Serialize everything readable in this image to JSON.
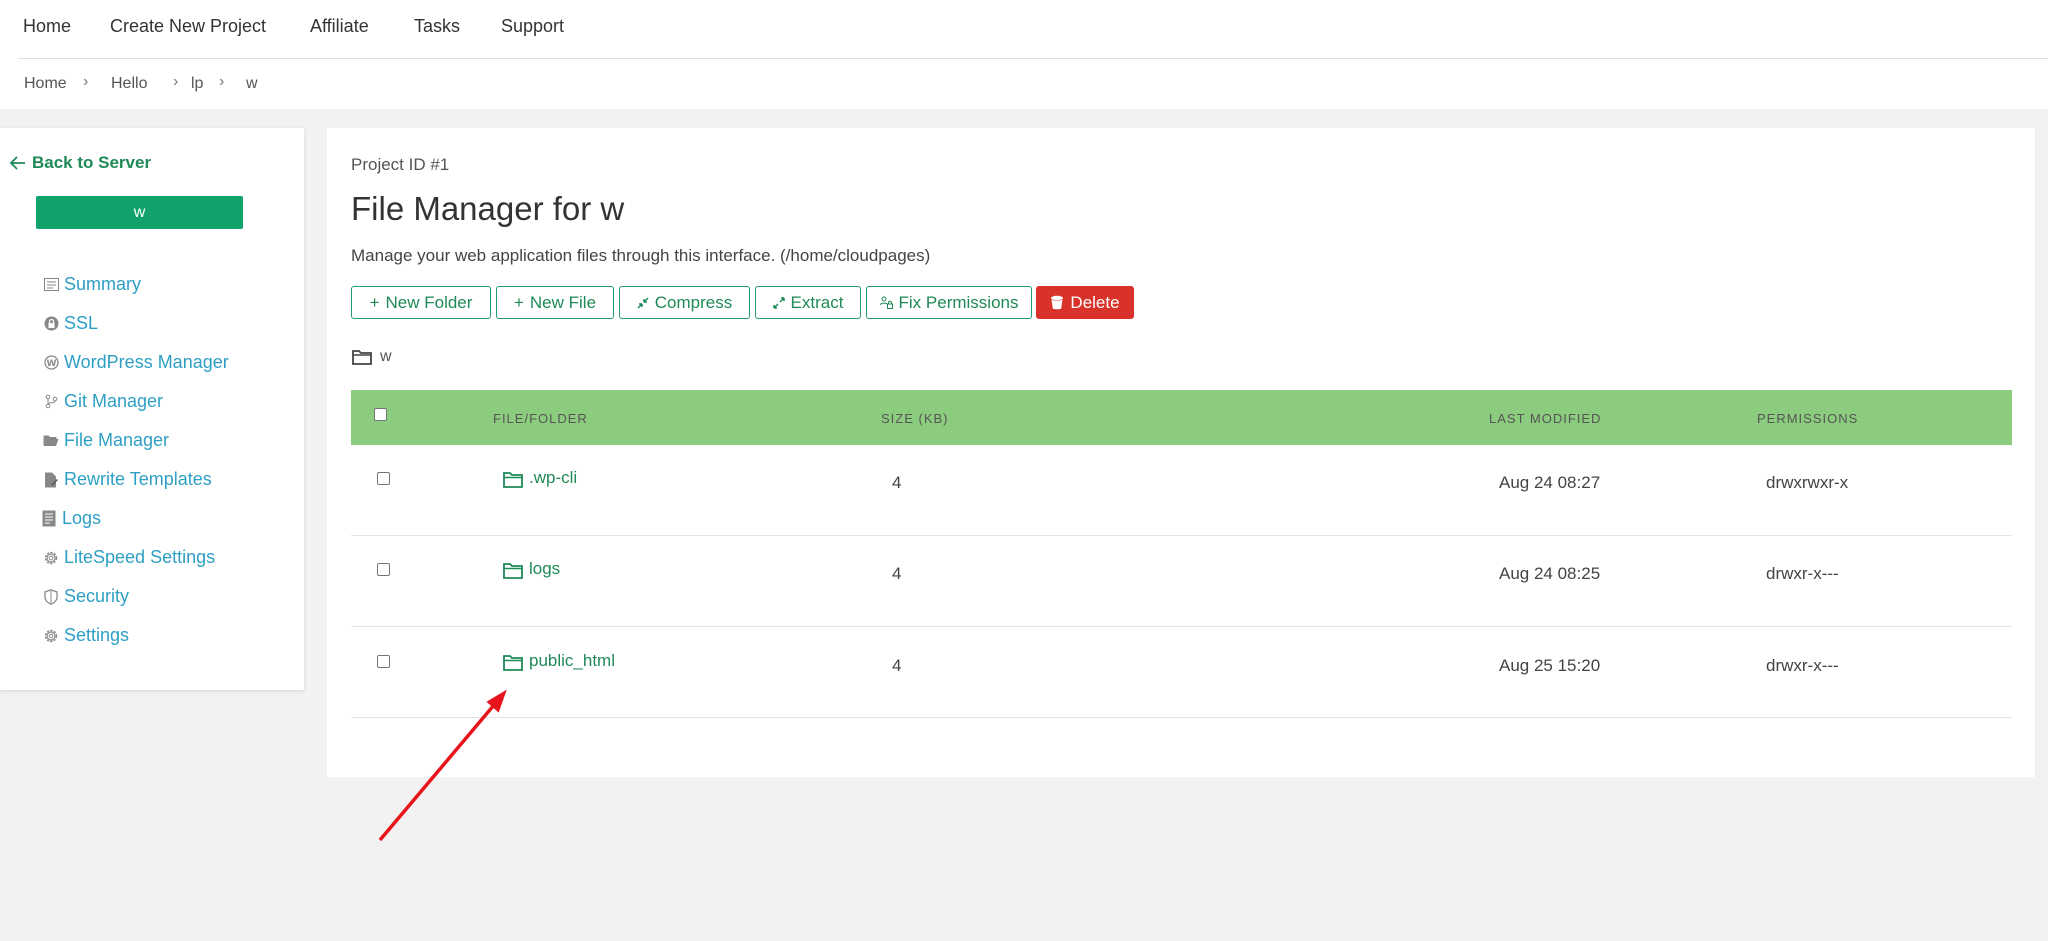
{
  "topnav": {
    "items": [
      "Home",
      "Create New Project",
      "Affiliate",
      "Tasks",
      "Support"
    ]
  },
  "breadcrumb": {
    "items": [
      "Home",
      "Hello",
      "lp",
      "w"
    ],
    "separator": "›"
  },
  "sidebar": {
    "back_label": "Back to Server",
    "project_name": "w",
    "items": [
      {
        "label": "Summary",
        "icon": "summary-icon"
      },
      {
        "label": "SSL",
        "icon": "lock-icon"
      },
      {
        "label": "WordPress Manager",
        "icon": "wordpress-icon"
      },
      {
        "label": "Git Manager",
        "icon": "git-icon"
      },
      {
        "label": "File Manager",
        "icon": "folder-open-icon"
      },
      {
        "label": "Rewrite Templates",
        "icon": "file-edit-icon"
      },
      {
        "label": "Logs",
        "icon": "logs-icon"
      },
      {
        "label": "LiteSpeed Settings",
        "icon": "gear-icon"
      },
      {
        "label": "Security",
        "icon": "shield-icon"
      },
      {
        "label": "Settings",
        "icon": "gear-icon"
      }
    ],
    "accent_color": "#10a26a",
    "link_color": "#2e9fc4"
  },
  "main": {
    "project_id": "Project ID #1",
    "title": "File Manager for w",
    "subtitle": "Manage your web application files through this interface. (/home/cloudpages)",
    "toolbar": {
      "new_folder": "New Folder",
      "new_file": "New File",
      "compress": "Compress",
      "extract": "Extract",
      "fix_permissions": "Fix Permissions",
      "delete": "Delete"
    },
    "current_path": "w",
    "table": {
      "headers": {
        "file": "FILE/FOLDER",
        "size": "SIZE (KB)",
        "modified": "LAST MODIFIED",
        "permissions": "PERMISSIONS"
      },
      "rows": [
        {
          "name": ".wp-cli",
          "size": "4",
          "modified": "Aug 24 08:27",
          "permissions": "drwxrwxr-x"
        },
        {
          "name": "logs",
          "size": "4",
          "modified": "Aug 24 08:25",
          "permissions": "drwxr-x---"
        },
        {
          "name": "public_html",
          "size": "4",
          "modified": "Aug 25 15:20",
          "permissions": "drwxr-x---"
        }
      ]
    },
    "header_color": "#8ccc7e",
    "delete_color": "#d9322b"
  },
  "annotation": {
    "color": "#e8141c"
  }
}
